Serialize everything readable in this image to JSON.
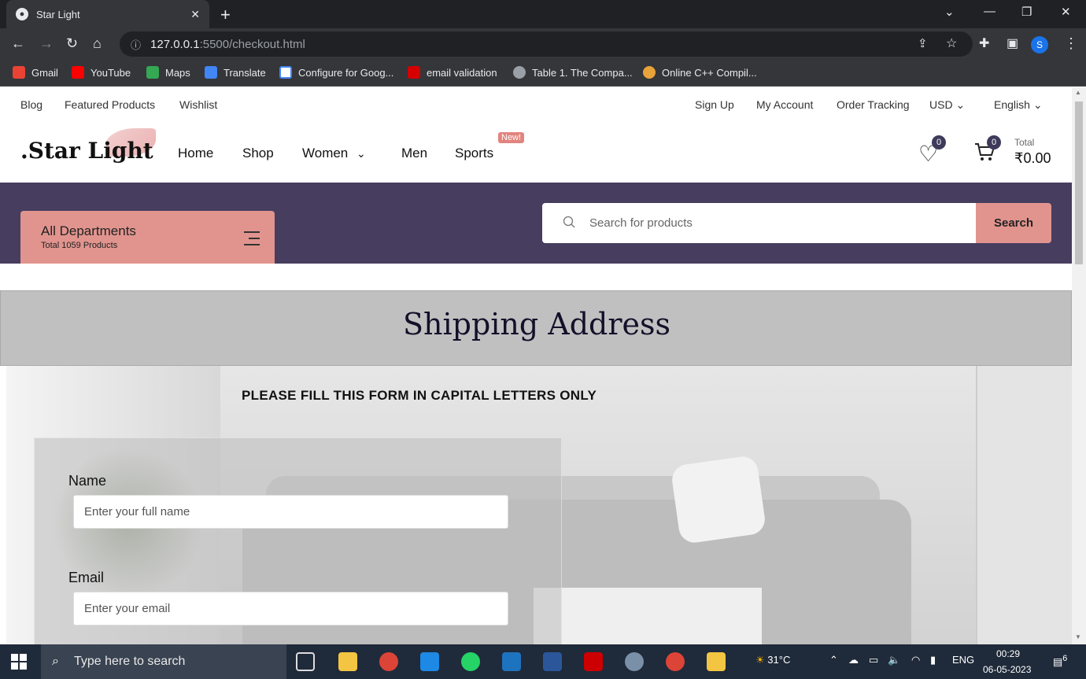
{
  "browser": {
    "tab_title": "Star Light",
    "url_host": "127.0.0.1",
    "url_rest": ":5500/checkout.html",
    "profile_initial": "S",
    "bookmarks": [
      "Gmail",
      "YouTube",
      "Maps",
      "Translate",
      "Configure for Goog...",
      "email validation",
      "Table 1. The Compa...",
      "Online C++ Compil..."
    ]
  },
  "topnav": {
    "left": [
      "Blog",
      "Featured Products",
      "Wishlist"
    ],
    "right": [
      "Sign Up",
      "My Account",
      "Order Tracking",
      "USD",
      "English"
    ]
  },
  "header": {
    "logo": ".Star Light",
    "nav": [
      "Home",
      "Shop",
      "Women",
      "Men",
      "Sports"
    ],
    "new_badge": "New!",
    "wishlist_count": "0",
    "cart_count": "0",
    "total_label": "Total",
    "total_value": "₹0.00"
  },
  "departments": {
    "title": "All Departments",
    "subtitle": "Total 1059 Products"
  },
  "search": {
    "placeholder": "Search for products",
    "button": "Search"
  },
  "page": {
    "heading": "Shipping Address",
    "notice": "PLEASE FILL THIS FORM IN CAPITAL LETTERS ONLY",
    "name_label": "Name",
    "name_placeholder": "Enter your full name",
    "email_label": "Email",
    "email_placeholder": "Enter your email"
  },
  "taskbar": {
    "search_placeholder": "Type here to search",
    "weather": "31°C",
    "lang": "ENG",
    "time": "00:29",
    "date": "06-05-2023",
    "notification_count": "6"
  },
  "colors": {
    "accent": "#e1948e",
    "band": "#463d5f",
    "browser_dark": "#35363a"
  }
}
